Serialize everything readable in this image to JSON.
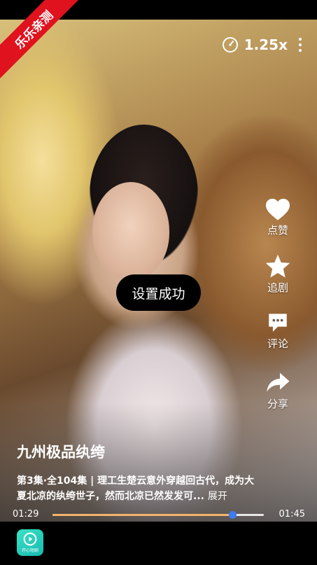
{
  "ribbon": {
    "text": "乐乐亲测"
  },
  "player": {
    "speed": "1.25x",
    "toast": "设置成功",
    "title": "九州极品纨绔",
    "description": "第3集·全104集 | 理工生楚云意外穿越回古代，成为大夏北凉的纨绔世子，然而北凉已然发发可...",
    "expand_label": "展开",
    "time_current": "01:29",
    "time_total": "01:45",
    "progress_fraction": 0.85
  },
  "actions": [
    {
      "icon": "heart-icon",
      "label": "点赞"
    },
    {
      "icon": "star-icon",
      "label": "追剧"
    },
    {
      "icon": "comment-icon",
      "label": "评论"
    },
    {
      "icon": "share-icon",
      "label": "分享"
    }
  ],
  "app": {
    "icon_text": "开心短剧"
  },
  "colors": {
    "ribbon": "#e0121e",
    "progress_fill": "#f2b36b",
    "knob": "#3b7cf0",
    "app_icon": "#2ad0bc"
  }
}
